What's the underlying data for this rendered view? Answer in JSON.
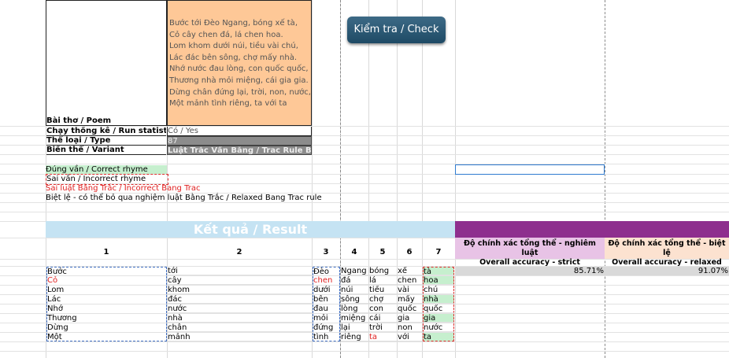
{
  "poem": {
    "label": "Bài thơ / Poem",
    "lines": [
      "Bước tới Đèo Ngang, bóng xế tà,",
      "Cỏ cây chen đá, lá chen hoa.",
      "Lom khom dưới núi, tiều vài chú,",
      "Lác đác bên sông, chợ mấy nhà.",
      "Nhớ nước đau lòng, con quốc quốc,",
      "Thương nhà mỏi miệng, cái gia gia.",
      "Dừng chân đứng lại, trời, non, nước,",
      "Một mảnh tình riêng, ta với ta"
    ]
  },
  "settings": {
    "run_label": "Chạy thống kê / Run statistics",
    "run_value": "Có / Yes",
    "type_label": "Thể loại / Type",
    "type_value": "87",
    "variant_label": "Biến thể / Variant",
    "variant_value": "Luật Trắc Vần Bằng / Trac Rule Bang R"
  },
  "check_button": "Kiểm tra / Check",
  "legend": {
    "correct": "Đúng vần / Correct rhyme",
    "incorrect": "Sai vần / Incorrect rhyme",
    "wrong_tone": "Sai luật Bằng Trắc / Incorrect Bang Trac",
    "exception": "Biệt lệ - có thể bỏ qua nghiệm luật Bằng Trắc / Relaxed Bang Trac rule"
  },
  "result_title": "Kết quả / Result",
  "column_headers": [
    "1",
    "2",
    "3",
    "4",
    "5",
    "6",
    "7"
  ],
  "accuracy": {
    "strict_label_1": "Độ chính xác tổng thể - nghiêm luật",
    "strict_label_2": "Overall accuracy - strict",
    "relaxed_label_1": "Độ chính xác tổng thể - biệt lệ",
    "relaxed_label_2": "Overall accuracy - relaxed",
    "strict_value": "85.71%",
    "relaxed_value": "91.07%"
  },
  "rows": [
    [
      "Bước",
      "tới",
      "Đèo",
      "Ngang",
      "bóng",
      "xế",
      "tà"
    ],
    [
      "Cỏ",
      "cây",
      "chen",
      "đá",
      "lá",
      "chen",
      "hoa"
    ],
    [
      "Lom",
      "khom",
      "dưới",
      "núi",
      "tiều",
      "vài",
      "chú"
    ],
    [
      "Lác",
      "đác",
      "bên",
      "sông",
      "chợ",
      "mấy",
      "nhà"
    ],
    [
      "Nhớ",
      "nước",
      "đau",
      "lòng",
      "con",
      "quốc",
      "quốc"
    ],
    [
      "Thương",
      "nhà",
      "mỏi",
      "miệng",
      "cái",
      "gia",
      "gia"
    ],
    [
      "Dừng",
      "chân",
      "đứng",
      "lại",
      "trời",
      "non",
      "nước"
    ],
    [
      "Một",
      "mảnh",
      "tình",
      "riêng",
      "ta",
      "với",
      "ta"
    ]
  ],
  "colors": {
    "poem_bg": "#fec897",
    "result_bg": "#c5e3f3",
    "purple": "#8e2f8e",
    "correct_green": "#c6efce",
    "error_red": "#e02020"
  }
}
